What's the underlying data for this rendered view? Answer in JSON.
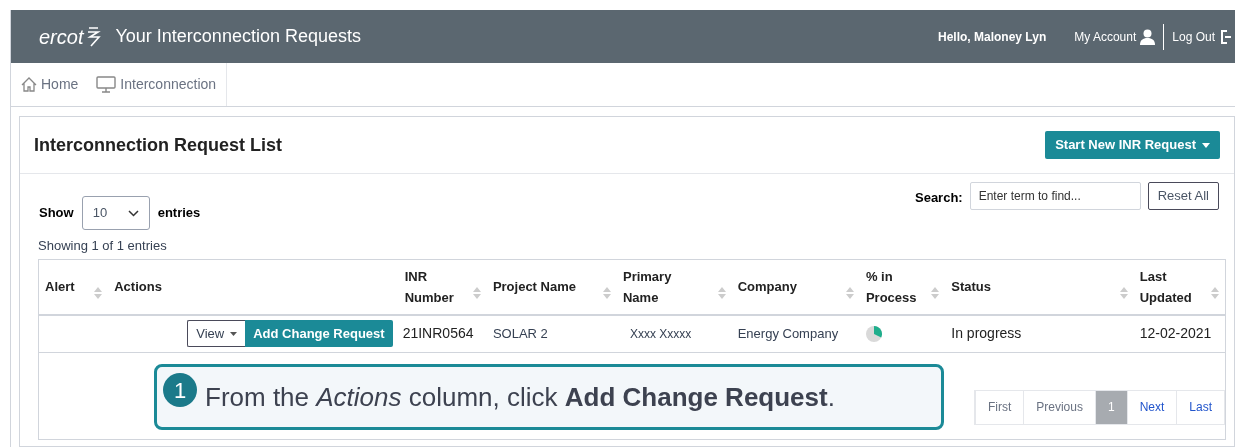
{
  "header": {
    "logo": "ercot",
    "title": "Your Interconnection Requests",
    "greeting": "Hello, Maloney Lyn",
    "account": "My Account",
    "logout": "Log Out"
  },
  "breadcrumb": [
    {
      "label": "Home",
      "kind": "home"
    },
    {
      "label": "Interconnection",
      "kind": "monitor"
    }
  ],
  "card": {
    "title": "Interconnection Request List",
    "new_button": "Start New INR Request"
  },
  "length": {
    "show": "Show",
    "value": "10",
    "entries": "entries"
  },
  "search": {
    "label": "Search:",
    "placeholder": "Enter term to find...",
    "reset": "Reset All"
  },
  "info": {
    "showing": "Showing",
    "from": "1 of",
    "total": "1",
    "entries": "entries"
  },
  "table": {
    "columns": [
      {
        "label": "Alert",
        "sortable": true
      },
      {
        "label": "Actions",
        "sortable": false
      },
      {
        "label": "INR Number",
        "sortable": true
      },
      {
        "label": "Project Name",
        "sortable": true
      },
      {
        "label": "Primary Name",
        "sortable": true
      },
      {
        "label": "Company",
        "sortable": true
      },
      {
        "label": "% in Process",
        "sortable": true
      },
      {
        "label": "Status",
        "sortable": true
      },
      {
        "label": "Last Updated",
        "sortable": true
      }
    ],
    "rows": [
      {
        "view": "View",
        "action": "Add Change Request",
        "inr": "21INR0564",
        "project": "SOLAR 2",
        "primary": "Xxxx Xxxxx",
        "company": "Energy Company",
        "status": "In progress",
        "updated": "12-02-2021"
      }
    ]
  },
  "pagination": [
    {
      "label": "First",
      "selected": false,
      "disabled": true
    },
    {
      "label": "Previous",
      "selected": false,
      "disabled": true
    },
    {
      "label": "1",
      "selected": true,
      "disabled": false
    },
    {
      "label": "Next",
      "selected": false,
      "disabled": false
    },
    {
      "label": "Last",
      "selected": false,
      "disabled": false
    }
  ],
  "callout": {
    "number": "1",
    "text": "From the *Actions* column, click **Add Change Request**."
  }
}
